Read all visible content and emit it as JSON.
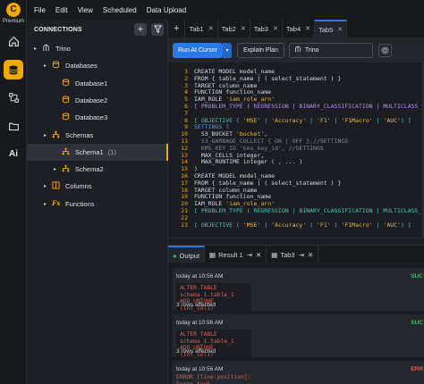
{
  "brand": {
    "logo_letter": "C",
    "label": "Premium"
  },
  "menu": [
    "File",
    "Edit",
    "View",
    "Scheduled",
    "Data Upload"
  ],
  "connections": {
    "title": "CONNECTIONS",
    "add_label": "+",
    "tree": [
      {
        "label": "Trino",
        "level": 0,
        "caret": "▸",
        "icon": "server-icon"
      },
      {
        "label": "Databases",
        "level": 1,
        "caret": "▸",
        "icon": "database-icon"
      },
      {
        "label": "Database1",
        "level": 2,
        "caret": "",
        "icon": "database-icon"
      },
      {
        "label": "Database2",
        "level": 2,
        "caret": "",
        "icon": "database-icon"
      },
      {
        "label": "Database3",
        "level": 2,
        "caret": "",
        "icon": "database-icon"
      },
      {
        "label": "Schemas",
        "level": 1,
        "caret": "▸",
        "icon": "schema-icon"
      },
      {
        "label": "Schema1",
        "level": 2,
        "caret": "",
        "icon": "schema-icon",
        "count": "(1)",
        "selected": true
      },
      {
        "label": "Schema2",
        "level": 2,
        "caret": "▸",
        "icon": "schema-icon"
      },
      {
        "label": "Columns",
        "level": 1,
        "caret": "▸",
        "icon": "columns-icon"
      },
      {
        "label": "Functions",
        "level": 1,
        "caret": "▸",
        "icon": "function-icon"
      }
    ]
  },
  "tabs": [
    {
      "label": "Tab1",
      "active": false
    },
    {
      "label": "Tab2",
      "active": false
    },
    {
      "label": "Tab3",
      "active": false
    },
    {
      "label": "Tab4",
      "active": false
    },
    {
      "label": "Tab5",
      "active": true
    }
  ],
  "toolbar": {
    "run_label": "Run At Cursor",
    "explain_label": "Explain Plan",
    "db_value": "Trino"
  },
  "editor": {
    "lines": [
      {
        "n": "1",
        "html": "<span class='kw'>CREATE MODEL</span> model_name"
      },
      {
        "n": "2",
        "html": "<span class='kw'>FROM</span> { table_name | ( select_statement ) }"
      },
      {
        "n": "3",
        "html": "<span class='kw'>TARGET</span> column_name"
      },
      {
        "n": "4",
        "html": "<span class='kw'>FUNCTION</span> function_name"
      },
      {
        "n": "5",
        "html": "<span class='kw'>IAM_ROLE</span> <span class='str'>'iam_role_arn'</span>"
      },
      {
        "n": "6",
        "html": "<span class='pur'>[ PROBLEM_TYPE ( REGRESSION | BINARY_CLASSIFICATION | MULTICLASS_CLA</span>"
      },
      {
        "n": "7",
        "html": ""
      },
      {
        "n": "8",
        "html": "<span class='tel'>[ OBJECTIVE ( </span><span class='str'>'MSE'</span><span class='tel'> | </span><span class='str'>'Accuracy'</span><span class='tel'> | </span><span class='str'>'F1'</span><span class='tel'> | </span><span class='str'>'F1Macro'</span><span class='tel'> | </span><span class='str'>'AUC'</span><span class='tel'>) ]</span>"
      },
      {
        "n": "9",
        "html": "<span class='lv'>SETTINGS (</span>"
      },
      {
        "n": "10",
        "html": "  S3_BUCKET <span class='str'>'bucket'</span>,"
      },
      {
        "n": "11",
        "html": "  <span class='cmt'>S3_GARBAGE_COLLECT { ON | OFF },//SETTINGS</span>"
      },
      {
        "n": "12",
        "html": "  <span class='cmt'>KMS_KEY_ID 'kms_key_id', //SETTINGS</span>"
      },
      {
        "n": "13",
        "html": "  MAX_CELLS <span class='kw'>integer</span>,"
      },
      {
        "n": "14",
        "html": "  MAX_RUNTIME <span class='kw'>integer</span> ( , ... )"
      },
      {
        "n": "15",
        "html": ")"
      },
      {
        "n": "16",
        "html": "<span class='kw'>CREATE MODEL</span> model_name"
      },
      {
        "n": "17",
        "html": "<span class='kw'>FROM</span> { table_name | ( select_statement ) }"
      },
      {
        "n": "18",
        "html": "<span class='kw'>TARGET</span> column_name"
      },
      {
        "n": "19",
        "html": "<span class='kw'>FUNCTION</span> function_name"
      },
      {
        "n": "20",
        "html": "<span class='kw'>IAM_ROLE</span> <span class='str'>'iam_role_arn'</span>"
      },
      {
        "n": "21",
        "html": "<span class='tel'>[ PROBLEM_TYPE ( REGRESSION | BINARY_CLASSIFICATION | MULTICLASS_CLA</span>"
      },
      {
        "n": "22",
        "html": ""
      },
      {
        "n": "23",
        "html": "<span class='tel'>[ OBJECTIVE ( </span><span class='str'>'MSE'</span><span class='tel'> | </span><span class='str'>'Accuracy'</span><span class='tel'> | </span><span class='str'>'F1'</span><span class='tel'> | </span><span class='str'>'F1Macro'</span><span class='tel'> | </span><span class='str'>'AUC'</span><span class='tel'>) ]</span>"
      }
    ]
  },
  "output": {
    "tabs": [
      {
        "label": "Output",
        "active": true
      },
      {
        "label": "Result 1",
        "active": false
      },
      {
        "label": "Tab3",
        "active": false
      }
    ],
    "cards": [
      {
        "time": "today at 10:56 AM",
        "status": "SUC",
        "status_color": "#3fbf6f",
        "sql": [
          "ALTER TABLE schema_1.table_1",
          "ADD UNIQUE (int_col1)"
        ],
        "affected": "3 rows affected"
      },
      {
        "time": "today at 10:56 AM",
        "status": "SUC",
        "status_color": "#3fbf6f",
        "sql": [
          "ALTER TABLE schema_1.table_1",
          "ADD UNIQUE (int_col1)"
        ],
        "affected": "3 rows affected"
      },
      {
        "time": "today at 10:56 AM",
        "status": "ERR",
        "status_color": "#e35d4d",
        "sql": [
          "ERROR [line:position]: Error text"
        ],
        "affected": ""
      }
    ]
  },
  "colors": {
    "accent": "#f2a900",
    "primary": "#2c7be5",
    "success": "#3fbf6f",
    "error": "#e35d4d"
  }
}
